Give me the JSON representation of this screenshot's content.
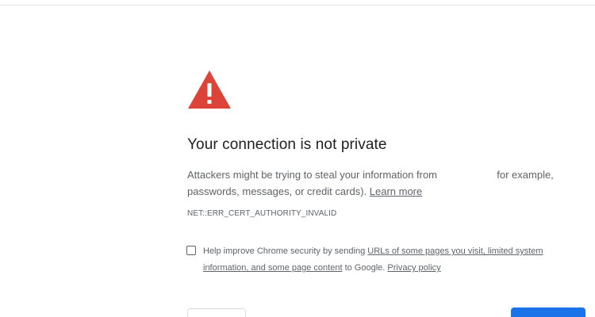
{
  "interstitial": {
    "heading": "Your connection is not private",
    "body": {
      "text_before": "Attackers might be trying to steal your information from",
      "text_after": "for example,",
      "line2_text": "passwords, messages, or credit cards).",
      "learn_more_link": "Learn more"
    },
    "error_code": "NET::ERR_CERT_AUTHORITY_INVALID",
    "optin": {
      "checked": false,
      "text_before": "Help improve Chrome security by sending",
      "link_line1": "URLs of some pages you visit, limited system",
      "link_line2": "information, and some page content",
      "text_middle": "to Google.",
      "privacy_link": "Privacy policy"
    }
  },
  "colors": {
    "warning": "#db4437",
    "primary_button": "#1a73e8",
    "text": "#202124",
    "secondary_text": "#5f6368"
  },
  "icons": {
    "warning": "warning-triangle-icon"
  }
}
